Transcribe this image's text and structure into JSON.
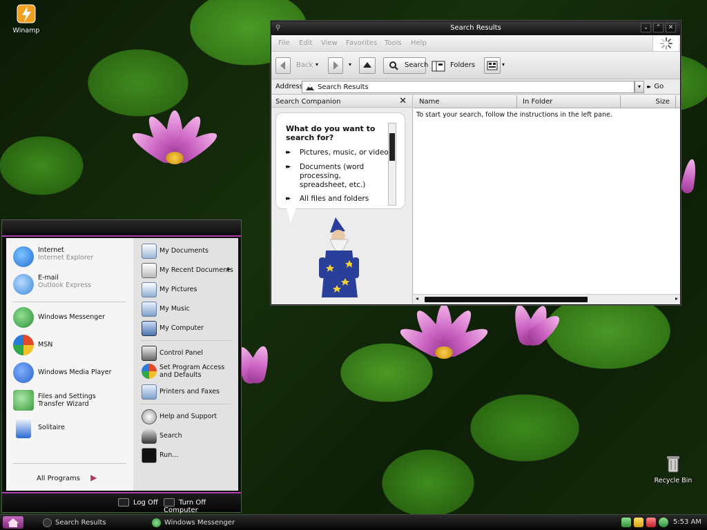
{
  "desktop": {
    "icons": [
      {
        "label": "Winamp",
        "glyph": "winamp-icon"
      },
      {
        "label": "Recycle Bin",
        "glyph": "recycle-bin-icon"
      }
    ]
  },
  "window": {
    "title": "Search Results",
    "controls": {
      "minimize": "⌄",
      "maximize": "⌃",
      "close": "✕"
    },
    "menu": [
      "File",
      "Edit",
      "View",
      "Favorites",
      "Tools",
      "Help"
    ],
    "toolbar": {
      "back": "Back",
      "search": "Search",
      "folders": "Folders"
    },
    "address": {
      "label": "Address",
      "value": "Search Results",
      "go": "Go"
    },
    "companion": {
      "header": "Search Companion",
      "close": "✕",
      "question": "What do you want to search for?",
      "options": [
        "Pictures, music, or video",
        "Documents (word processing, spreadsheet, etc.)",
        "All files and folders"
      ]
    },
    "results": {
      "columns": [
        "Name",
        "In Folder",
        "Size"
      ],
      "empty_message": "To start your search, follow the instructions in the left pane."
    }
  },
  "start_menu": {
    "pinned": [
      {
        "label": "Internet",
        "sub": "Internet Explorer",
        "icon": "internet-explorer-icon",
        "color": "#1f6fd1"
      },
      {
        "label": "E-mail",
        "sub": "Outlook Express",
        "icon": "outlook-express-icon",
        "color": "#3a86d8"
      }
    ],
    "recent": [
      {
        "label": "Windows Messenger",
        "icon": "messenger-icon",
        "color": "#2f8f3a"
      },
      {
        "label": "MSN",
        "icon": "msn-icon",
        "color": "#e04a2a"
      },
      {
        "label": "Windows Media Player",
        "icon": "media-player-icon",
        "color": "#2a62c8"
      },
      {
        "label": "Files and Settings Transfer Wizard",
        "icon": "transfer-wizard-icon",
        "color": "#3e9b3e"
      },
      {
        "label": "Solitaire",
        "icon": "solitaire-icon",
        "color": "#2a6ad0"
      }
    ],
    "all_programs": "All Programs",
    "right": [
      {
        "label": "My Documents",
        "icon": "my-documents-icon"
      },
      {
        "label": "My Recent Documents",
        "icon": "recent-documents-icon",
        "arrow": "▸"
      },
      {
        "label": "My Pictures",
        "icon": "my-pictures-icon"
      },
      {
        "label": "My Music",
        "icon": "my-music-icon"
      },
      {
        "label": "My Computer",
        "icon": "my-computer-icon"
      },
      {
        "label": "Control Panel",
        "icon": "control-panel-icon"
      },
      {
        "label": "Set Program Access and Defaults",
        "icon": "program-access-icon"
      },
      {
        "label": "Printers and Faxes",
        "icon": "printers-icon"
      },
      {
        "label": "Help and Support",
        "icon": "help-icon"
      },
      {
        "label": "Search",
        "icon": "search-icon"
      },
      {
        "label": "Run...",
        "icon": "run-icon"
      }
    ],
    "log_off": "Log Off",
    "turn_off": "Turn Off Computer"
  },
  "taskbar": {
    "items": [
      {
        "label": "Search Results",
        "icon": "search-icon"
      },
      {
        "label": "Windows Messenger",
        "icon": "messenger-icon"
      }
    ],
    "clock": "5:53 AM"
  }
}
